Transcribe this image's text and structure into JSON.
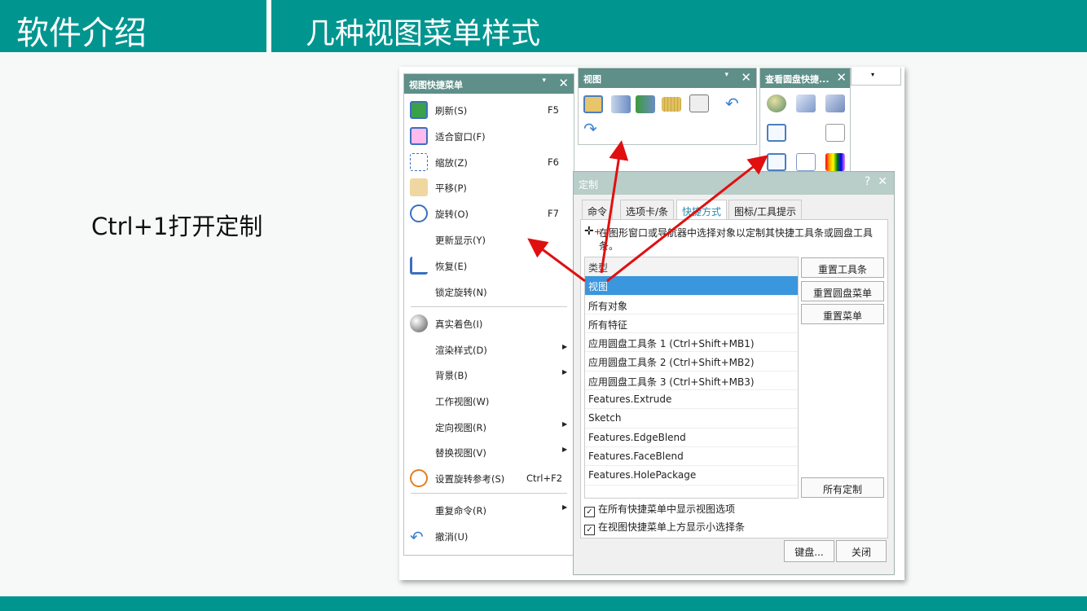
{
  "header": {
    "section": "软件介绍",
    "title": "几种视图菜单样式"
  },
  "side_note": "Ctrl+1打开定制",
  "view_menu": {
    "title": "视图快捷菜单",
    "items": [
      {
        "label": "刷新(S)",
        "shortcut": "F5",
        "icon": "refresh-icon"
      },
      {
        "label": "适合窗口(F)",
        "shortcut": "",
        "icon": "fit-window-icon"
      },
      {
        "label": "缩放(Z)",
        "shortcut": "F6",
        "icon": "zoom-icon"
      },
      {
        "label": "平移(P)",
        "shortcut": "",
        "icon": "pan-icon"
      },
      {
        "label": "旋转(O)",
        "shortcut": "F7",
        "icon": "rotate-icon"
      },
      {
        "label": "更新显示(Y)",
        "shortcut": "",
        "icon": ""
      },
      {
        "label": "恢复(E)",
        "shortcut": "",
        "icon": "restore-icon"
      },
      {
        "label": "锁定旋转(N)",
        "shortcut": "",
        "icon": ""
      },
      {
        "label": "真实着色(I)",
        "shortcut": "",
        "icon": "true-shading-icon"
      },
      {
        "label": "渲染样式(D)",
        "shortcut": "",
        "icon": "",
        "submenu": true
      },
      {
        "label": "背景(B)",
        "shortcut": "",
        "icon": "",
        "submenu": true
      },
      {
        "label": "工作视图(W)",
        "shortcut": "",
        "icon": ""
      },
      {
        "label": "定向视图(R)",
        "shortcut": "",
        "icon": "",
        "submenu": true
      },
      {
        "label": "替换视图(V)",
        "shortcut": "",
        "icon": "",
        "submenu": true
      },
      {
        "label": "设置旋转参考(S)",
        "shortcut": "Ctrl+F2",
        "icon": "rotate-reference-icon"
      },
      {
        "label": "重复命令(R)",
        "shortcut": "",
        "icon": "",
        "submenu": true
      },
      {
        "label": "撤消(U)",
        "shortcut": "",
        "icon": "undo-icon"
      }
    ]
  },
  "view_toolbar": {
    "title": "视图"
  },
  "radial_toolbar": {
    "title": "查看圆盘快捷..."
  },
  "dialog": {
    "title": "定制",
    "help": "?",
    "tabs": [
      "命令",
      "选项卡/条",
      "快捷方式",
      "图标/工具提示"
    ],
    "active_tab": 2,
    "hint": "在图形窗口或导航器中选择对象以定制其快捷工具条或圆盘工具条。",
    "column": "类型",
    "rows": [
      "视图",
      "所有对象",
      "所有特征",
      "应用圆盘工具条 1 (Ctrl+Shift+MB1)",
      "应用圆盘工具条 2 (Ctrl+Shift+MB2)",
      "应用圆盘工具条 3 (Ctrl+Shift+MB3)",
      "Features.Extrude",
      "Sketch",
      "Features.EdgeBlend",
      "Features.FaceBlend",
      "Features.HolePackage"
    ],
    "selected_row": 0,
    "buttons": {
      "reset_toolbar": "重置工具条",
      "reset_radial": "重置圆盘菜单",
      "reset_menu": "重置菜单",
      "all_custom": "所有定制",
      "keyboard": "键盘...",
      "close": "关闭"
    },
    "checkboxes": [
      {
        "label": "在所有快捷菜单中显示视图选项",
        "checked": true
      },
      {
        "label": "在视图快捷菜单上方显示小选择条",
        "checked": true
      }
    ]
  },
  "colors": {
    "accent": "#00958f",
    "panel_title": "#5e8f89",
    "selection": "#3a96dd",
    "arrow": "#e01010"
  }
}
